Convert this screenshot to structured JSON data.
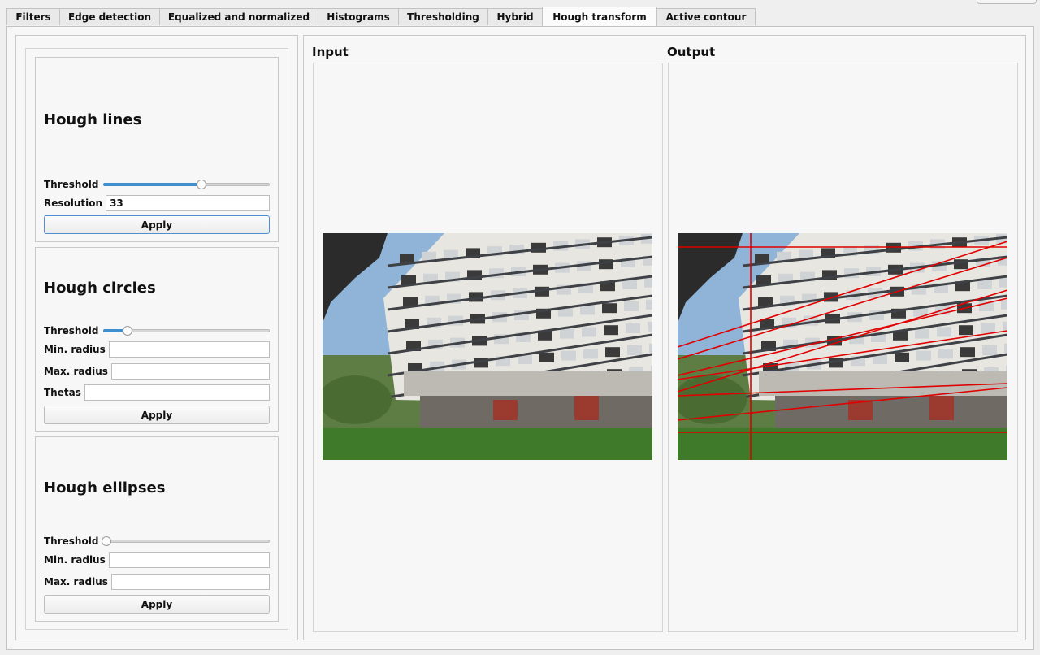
{
  "tabs": [
    {
      "label": "Filters",
      "active": false
    },
    {
      "label": "Edge detection",
      "active": false
    },
    {
      "label": "Equalized and normalized",
      "active": false
    },
    {
      "label": "Histograms",
      "active": false
    },
    {
      "label": "Thresholding",
      "active": false
    },
    {
      "label": "Hybrid",
      "active": false
    },
    {
      "label": "Hough transform",
      "active": true
    },
    {
      "label": "Active contour",
      "active": false
    }
  ],
  "hough_lines": {
    "title": "Hough lines",
    "threshold_label": "Threshold",
    "threshold_level": 0.6,
    "resolution_label": "Resolution",
    "resolution_value": "33",
    "apply_label": "Apply"
  },
  "hough_circles": {
    "title": "Hough circles",
    "threshold_label": "Threshold",
    "threshold_level": 0.13,
    "min_radius_label": "Min. radius",
    "min_radius_value": "",
    "max_radius_label": "Max. radius",
    "max_radius_value": "",
    "thetas_label": "Thetas",
    "thetas_value": "",
    "apply_label": "Apply"
  },
  "hough_ellipses": {
    "title": "Hough ellipses",
    "threshold_label": "Threshold",
    "threshold_level": 0.0,
    "min_radius_label": "Min. radius",
    "min_radius_value": "",
    "max_radius_label": "Max. radius",
    "max_radius_value": "",
    "apply_label": "Apply"
  },
  "input_panel": {
    "title": "Input"
  },
  "output_panel": {
    "title": "Output"
  },
  "colors": {
    "slider_fill": "#3d8fd0",
    "hough_line": "#e00000",
    "sky": "#8fb4d8",
    "building": "#e8e6e0",
    "grass": "#3f7a2a"
  }
}
